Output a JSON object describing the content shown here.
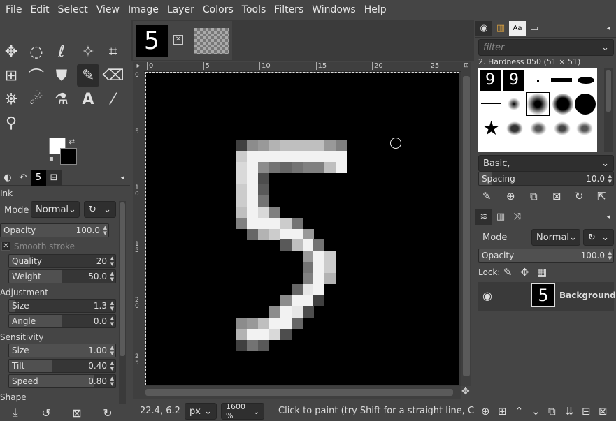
{
  "menubar": [
    "File",
    "Edit",
    "Select",
    "View",
    "Image",
    "Layer",
    "Colors",
    "Tools",
    "Filters",
    "Windows",
    "Help"
  ],
  "image_tab": {
    "thumb_label": "5",
    "close_icon": "close-icon"
  },
  "tool_options": {
    "title": "Ink",
    "mode_label": "Mode",
    "mode_value": "Normal",
    "opacity_label": "Opacity",
    "opacity_value": "100.0",
    "opacity_fraction": 1.0,
    "smooth_stroke": "Smooth stroke",
    "quality_label": "Quality",
    "quality_value": "20",
    "quality_fraction": 0.2,
    "weight_label": "Weight",
    "weight_value": "50.0",
    "weight_fraction": 0.5,
    "adjustment": "Adjustment",
    "size_label": "Size",
    "size_value": "1.3",
    "size_fraction": 0.06,
    "angle_label": "Angle",
    "angle_value": "0.0",
    "angle_fraction": 0.5,
    "sensitivity": "Sensitivity",
    "sens_size_label": "Size",
    "sens_size_value": "1.00",
    "sens_size_fraction": 1.0,
    "tilt_label": "Tilt",
    "tilt_value": "0.40",
    "tilt_fraction": 0.4,
    "speed_label": "Speed",
    "speed_value": "0.80",
    "speed_fraction": 0.8,
    "shape": "Shape"
  },
  "ruler_top": [
    "0",
    "5",
    "10",
    "15",
    "20",
    "25"
  ],
  "ruler_left": [
    "0",
    "5",
    "1\n0",
    "1\n5",
    "2\n0",
    "2\n5"
  ],
  "statusbar": {
    "coords": "22.4, 6.2",
    "unit": "px",
    "zoom": "1600 %",
    "message": "Click to paint (try Shift for a straight line, Ct..."
  },
  "brushes": {
    "filter_placeholder": "filter",
    "brush_name": "2. Hardness 050 (51 × 51)",
    "preset": "Basic,",
    "spacing_label": "Spacing",
    "spacing_value": "10.0",
    "spacing_fraction": 0.1
  },
  "layers": {
    "mode_label": "Mode",
    "mode_value": "Normal",
    "opacity_label": "Opacity",
    "opacity_value": "100.0",
    "lock_label": "Lock:",
    "layer_name": "Background",
    "layer_thumb": "5"
  },
  "digit_pixels": [
    [
      8,
      6,
      0.25
    ],
    [
      9,
      6,
      0.55
    ],
    [
      10,
      6,
      0.6
    ],
    [
      11,
      6,
      0.7
    ],
    [
      12,
      6,
      0.75
    ],
    [
      13,
      6,
      0.75
    ],
    [
      14,
      6,
      0.75
    ],
    [
      15,
      6,
      0.75
    ],
    [
      16,
      6,
      0.6
    ],
    [
      17,
      6,
      0.5
    ],
    [
      8,
      7,
      0.8
    ],
    [
      9,
      7,
      0.95
    ],
    [
      10,
      7,
      0.95
    ],
    [
      11,
      7,
      0.95
    ],
    [
      12,
      7,
      0.95
    ],
    [
      13,
      7,
      0.95
    ],
    [
      14,
      7,
      0.95
    ],
    [
      15,
      7,
      0.95
    ],
    [
      16,
      7,
      0.95
    ],
    [
      17,
      7,
      0.95
    ],
    [
      8,
      8,
      0.85
    ],
    [
      9,
      8,
      0.95
    ],
    [
      10,
      8,
      0.55
    ],
    [
      11,
      8,
      0.45
    ],
    [
      12,
      8,
      0.4
    ],
    [
      13,
      8,
      0.45
    ],
    [
      14,
      8,
      0.5
    ],
    [
      15,
      8,
      0.5
    ],
    [
      16,
      8,
      0.75
    ],
    [
      17,
      8,
      0.95
    ],
    [
      8,
      9,
      0.85
    ],
    [
      9,
      9,
      0.95
    ],
    [
      10,
      9,
      0.3
    ],
    [
      8,
      10,
      0.8
    ],
    [
      9,
      10,
      0.95
    ],
    [
      10,
      10,
      0.35
    ],
    [
      8,
      11,
      0.8
    ],
    [
      9,
      11,
      0.95
    ],
    [
      10,
      11,
      0.45
    ],
    [
      8,
      12,
      0.75
    ],
    [
      9,
      12,
      0.95
    ],
    [
      10,
      12,
      0.85
    ],
    [
      11,
      12,
      0.5
    ],
    [
      8,
      13,
      0.5
    ],
    [
      9,
      13,
      0.95
    ],
    [
      10,
      13,
      0.95
    ],
    [
      11,
      13,
      0.95
    ],
    [
      12,
      13,
      0.8
    ],
    [
      13,
      13,
      0.45
    ],
    [
      9,
      14,
      0.4
    ],
    [
      10,
      14,
      0.7
    ],
    [
      11,
      14,
      0.8
    ],
    [
      12,
      14,
      0.95
    ],
    [
      13,
      14,
      0.95
    ],
    [
      14,
      14,
      0.6
    ],
    [
      12,
      15,
      0.35
    ],
    [
      13,
      15,
      0.75
    ],
    [
      14,
      15,
      0.95
    ],
    [
      15,
      15,
      0.45
    ],
    [
      14,
      16,
      0.6
    ],
    [
      15,
      16,
      0.95
    ],
    [
      16,
      16,
      0.8
    ],
    [
      14,
      17,
      0.45
    ],
    [
      15,
      17,
      0.95
    ],
    [
      16,
      17,
      0.8
    ],
    [
      14,
      18,
      0.5
    ],
    [
      15,
      18,
      0.95
    ],
    [
      16,
      18,
      0.7
    ],
    [
      13,
      19,
      0.4
    ],
    [
      14,
      19,
      0.9
    ],
    [
      15,
      19,
      0.95
    ],
    [
      12,
      20,
      0.55
    ],
    [
      13,
      20,
      0.95
    ],
    [
      14,
      20,
      0.95
    ],
    [
      15,
      20,
      0.25
    ],
    [
      11,
      21,
      0.55
    ],
    [
      12,
      21,
      0.95
    ],
    [
      13,
      21,
      0.9
    ],
    [
      14,
      21,
      0.3
    ],
    [
      8,
      22,
      0.55
    ],
    [
      9,
      22,
      0.6
    ],
    [
      10,
      22,
      0.75
    ],
    [
      11,
      22,
      0.95
    ],
    [
      12,
      22,
      0.95
    ],
    [
      13,
      22,
      0.4
    ],
    [
      8,
      23,
      0.7
    ],
    [
      9,
      23,
      0.95
    ],
    [
      10,
      23,
      0.95
    ],
    [
      11,
      23,
      0.85
    ],
    [
      12,
      23,
      0.3
    ],
    [
      8,
      24,
      0.25
    ],
    [
      9,
      24,
      0.45
    ],
    [
      10,
      24,
      0.35
    ]
  ]
}
